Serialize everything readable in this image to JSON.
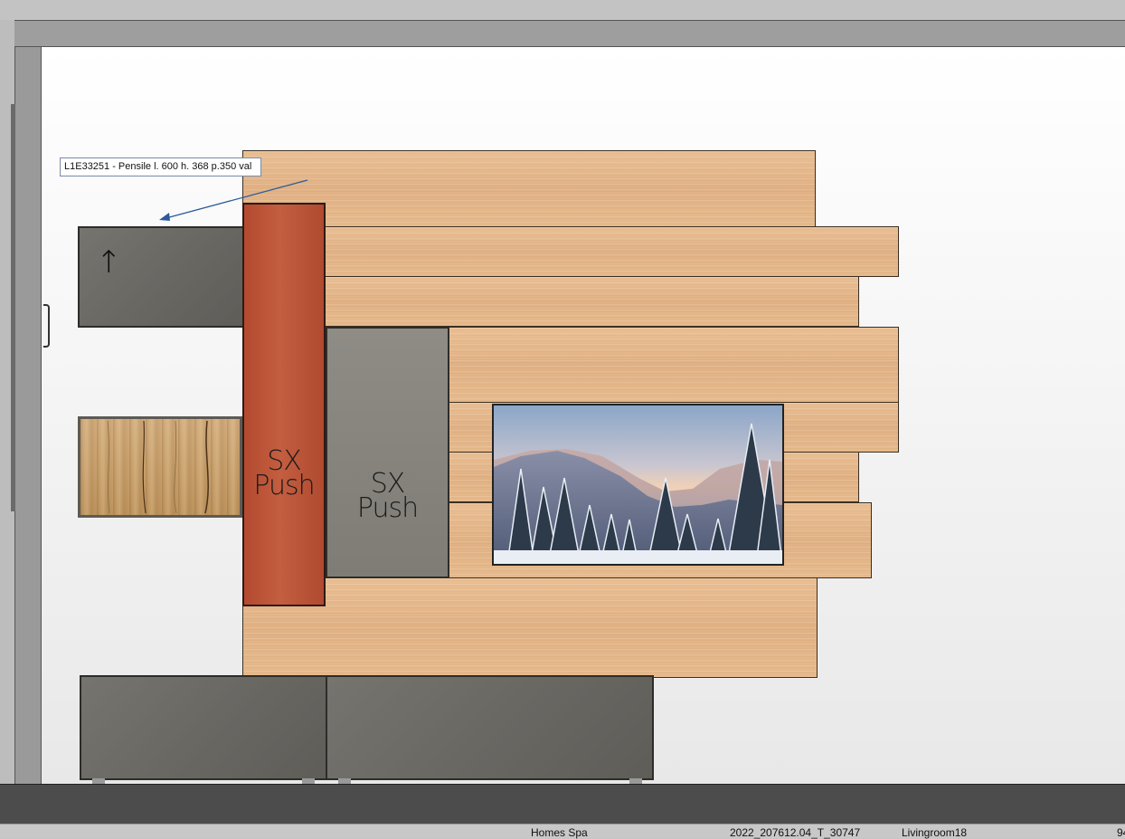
{
  "tooltip": {
    "text": "L1E33251 - Pensile   l. 600 h. 368 p.350  val"
  },
  "panels": {
    "red_label_line1": "SX",
    "red_label_line2": "Push",
    "grey_label_line1": "SX",
    "grey_label_line2": "Push"
  },
  "wall_unit": {
    "arrow_glyph": "↑"
  },
  "status_bar": {
    "company": "Homes Spa",
    "code": "2022_207612.04_T_30747",
    "room": "Livingroom18",
    "page": "94"
  },
  "colors": {
    "arrow": "#2a5a9a",
    "red_panel": "#b85236",
    "grey_unit": "#6d6b66"
  }
}
